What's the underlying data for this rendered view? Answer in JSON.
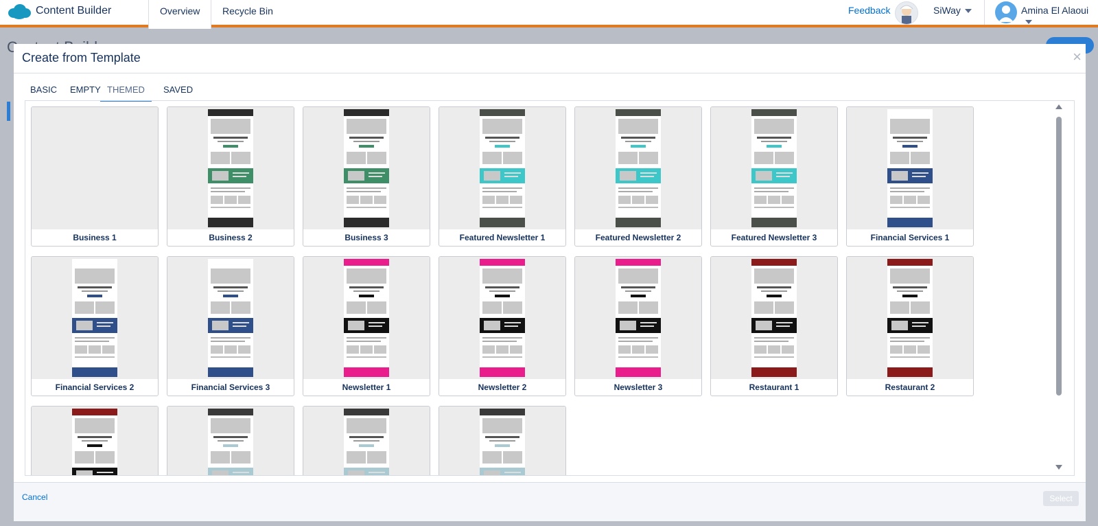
{
  "app": {
    "title": "Content Builder",
    "brand_color": "#e07b24"
  },
  "nav": {
    "tabs": [
      {
        "label": "Overview",
        "active": true
      },
      {
        "label": "Recycle Bin",
        "active": false
      }
    ]
  },
  "header": {
    "feedback": "Feedback",
    "org": "SiWay",
    "user": "Amina El Alaoui"
  },
  "background": {
    "page_title": "Content Builder"
  },
  "modal": {
    "title": "Create from Template",
    "close_icon": "close-icon",
    "tabs": [
      {
        "label": "BASIC",
        "active": false
      },
      {
        "label": "EMPTY",
        "active": false
      },
      {
        "label": "THEMED",
        "active": true
      },
      {
        "label": "SAVED",
        "active": false
      }
    ],
    "templates": [
      {
        "label": "Business 1",
        "style": "blank"
      },
      {
        "label": "Business 2",
        "style": "dark"
      },
      {
        "label": "Business 3",
        "style": "dark"
      },
      {
        "label": "Featured Newsletter 1",
        "style": "feature"
      },
      {
        "label": "Featured Newsletter 2",
        "style": "feature"
      },
      {
        "label": "Featured Newsletter 3",
        "style": "feature"
      },
      {
        "label": "Financial Services 1",
        "style": "finance"
      },
      {
        "label": "Financial Services 2",
        "style": "finance"
      },
      {
        "label": "Financial Services 3",
        "style": "finance"
      },
      {
        "label": "Newsletter 1",
        "style": "pink"
      },
      {
        "label": "Newsletter 2",
        "style": "pink"
      },
      {
        "label": "Newsletter 3",
        "style": "pink"
      },
      {
        "label": "Restaurant 1",
        "style": "red"
      },
      {
        "label": "Restaurant 2",
        "style": "red"
      },
      {
        "label": "",
        "style": "red"
      },
      {
        "label": "",
        "style": "teal"
      },
      {
        "label": "",
        "style": "teal"
      },
      {
        "label": "",
        "style": "teal"
      }
    ],
    "footer": {
      "cancel": "Cancel",
      "select": "Select"
    }
  }
}
